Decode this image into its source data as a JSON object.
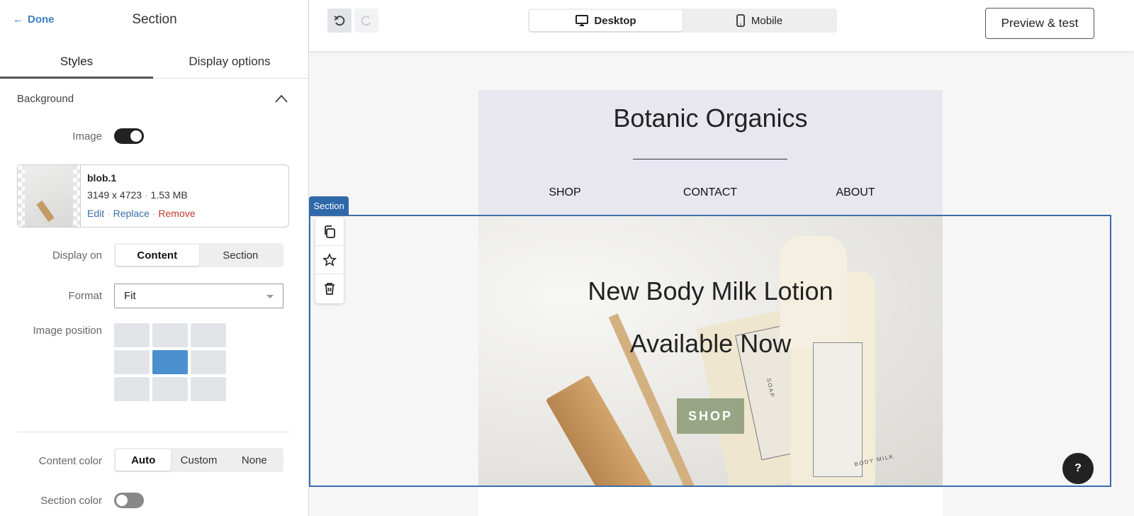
{
  "panel": {
    "done_label": "Done",
    "title": "Section",
    "tabs": [
      {
        "label": "Styles",
        "active": true
      },
      {
        "label": "Display options",
        "active": false
      }
    ],
    "background": {
      "heading": "Background",
      "image_label": "Image",
      "image_enabled": true,
      "file": {
        "name": "blob.1",
        "dimensions": "3149 x 4723",
        "size": "1.53 MB",
        "edit": "Edit",
        "replace": "Replace",
        "remove": "Remove"
      },
      "display_on_label": "Display on",
      "display_on_options": [
        "Content",
        "Section"
      ],
      "display_on_selected": "Content",
      "format_label": "Format",
      "format_value": "Fit",
      "position_label": "Image position",
      "position_selected": "center"
    },
    "content_color_label": "Content color",
    "content_color_options": [
      "Auto",
      "Custom",
      "None"
    ],
    "content_color_selected": "Auto",
    "section_color_label": "Section color",
    "section_color_enabled": false
  },
  "toolbar": {
    "devices": [
      "Desktop",
      "Mobile"
    ],
    "device_selected": "Desktop",
    "preview_label": "Preview & test"
  },
  "email": {
    "brand": "Botanic Organics",
    "nav": [
      "SHOP",
      "CONTACT",
      "ABOUT"
    ],
    "hero_line1": "New Body Milk Lotion",
    "hero_line2": "Available Now",
    "cta": "SHOP",
    "cta_color": "#97a585",
    "photo_text": [
      "SOAP",
      "BODY MILK"
    ]
  },
  "selection": {
    "tag": "Section",
    "color": "#2f68a8"
  },
  "help_label": "?"
}
